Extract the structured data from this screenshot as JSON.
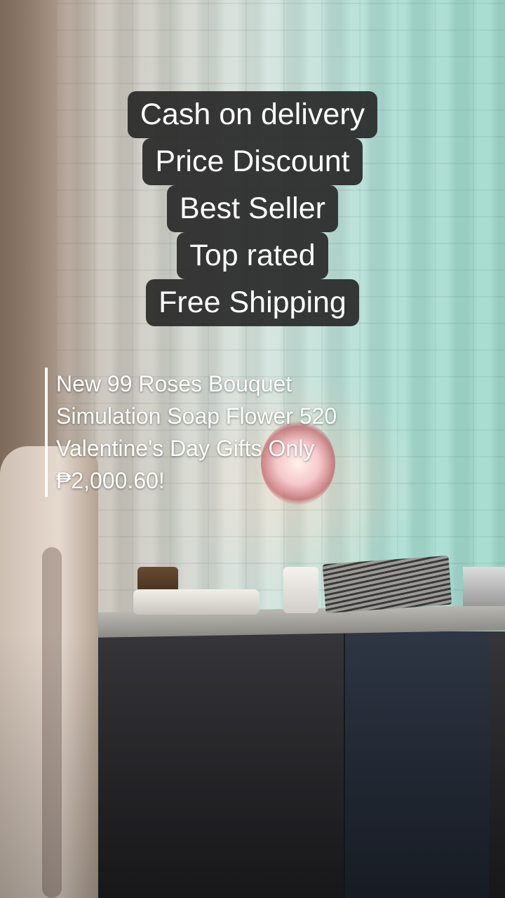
{
  "badges": [
    "Cash on delivery",
    "Price Discount",
    "Best Seller",
    "Top rated",
    "Free Shipping"
  ],
  "caption": {
    "lines": [
      "New 99 Roses Bouquet",
      "Simulation Soap Flower 520",
      "Valentine's Day Gifts Only",
      "₱2,000.60!"
    ]
  },
  "colors": {
    "badge_background": "#282828",
    "text": "#ffffff",
    "caption_rule": "#ffffff"
  }
}
